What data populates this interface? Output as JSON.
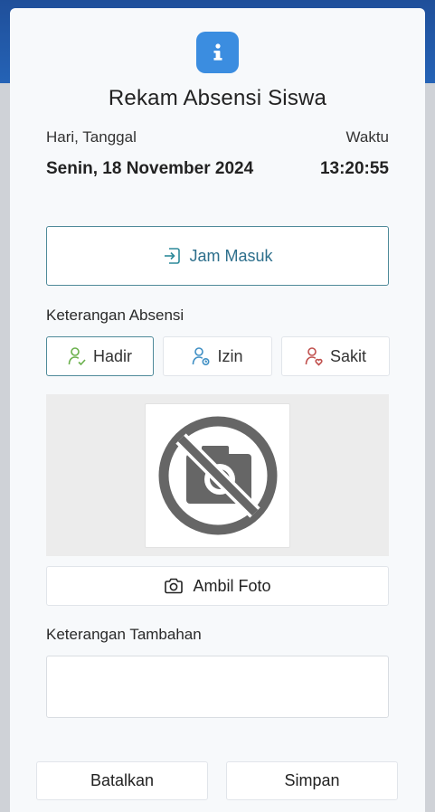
{
  "modal": {
    "title": "Rekam Absensi Siswa",
    "date_label": "Hari, Tanggal",
    "date_value": "Senin, 18 November 2024",
    "time_label": "Waktu",
    "time_value": "13:20:55",
    "clock_in_label": "Jam Masuk",
    "attendance_label": "Keterangan Absensi",
    "statuses": [
      {
        "label": "Hadir",
        "icon": "user-check-icon",
        "selected": true
      },
      {
        "label": "Izin",
        "icon": "user-clock-icon",
        "selected": false
      },
      {
        "label": "Sakit",
        "icon": "user-heart-icon",
        "selected": false
      }
    ],
    "photo_placeholder_icon": "no-camera-icon",
    "take_photo_label": "Ambil Foto",
    "notes_label": "Keterangan Tambahan",
    "notes_value": "",
    "cancel_label": "Batalkan",
    "save_label": "Simpan"
  },
  "colors": {
    "header_blue": "#2563b6",
    "info_badge": "#3b8de0",
    "teal_accent": "#2d6f8c",
    "hadir_green": "#6ab04c",
    "izin_blue": "#3f8fc4",
    "sakit_red": "#c0504d"
  }
}
